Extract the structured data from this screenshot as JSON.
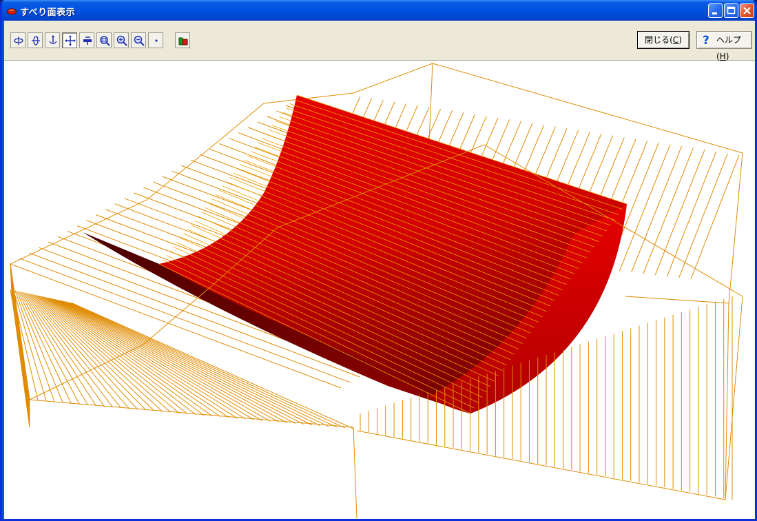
{
  "window": {
    "title": "すべり面表示"
  },
  "toolbar": {
    "tools": [
      {
        "name": "rotate-x-icon"
      },
      {
        "name": "rotate-y-icon"
      },
      {
        "name": "rotate-z-icon"
      },
      {
        "name": "pan-icon",
        "active": true
      },
      {
        "name": "move-icon"
      },
      {
        "name": "zoom-window-icon"
      },
      {
        "name": "zoom-in-icon"
      },
      {
        "name": "zoom-out-icon"
      },
      {
        "name": "point-icon"
      },
      {
        "name": "color-settings-icon"
      }
    ],
    "close_label": "閉じる(C)",
    "close_label_text": "閉じる(",
    "close_label_key": "C",
    "close_label_end": ")",
    "help_label_text": "ヘルプ(",
    "help_label_key": "H",
    "help_label_end": ")"
  },
  "view": {
    "surface_color": "#e00000",
    "wire_color": "#e08b00"
  }
}
